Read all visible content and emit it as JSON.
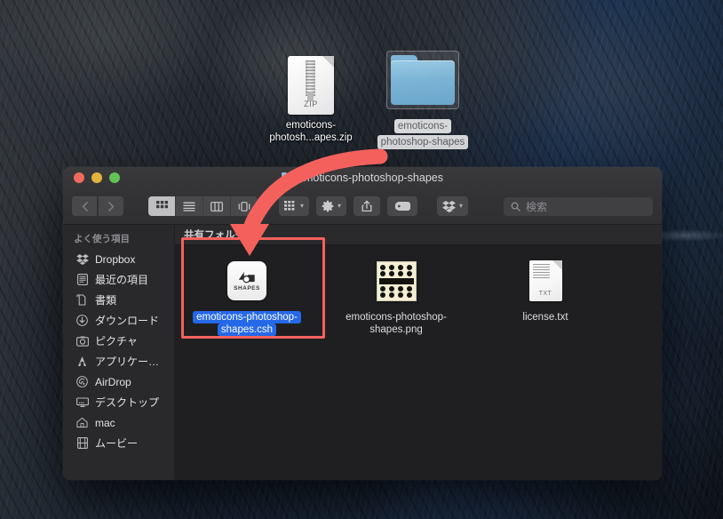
{
  "desktop": {
    "icons": [
      {
        "name": "emoticons-photosh...apes.zip",
        "type": "zip-file-icon",
        "badge": "ZIP",
        "selected": false
      },
      {
        "name_line1": "emoticons-",
        "name_line2": "photoshop-shapes",
        "type": "folder-icon",
        "selected": true
      }
    ]
  },
  "window": {
    "title": "emoticons-photoshop-shapes",
    "traffic_lights": [
      "close",
      "minimize",
      "zoom"
    ],
    "toolbar": {
      "back_label": "‹",
      "forward_label": "›",
      "view_modes": [
        {
          "id": "icon-view",
          "label": "icon",
          "active": true
        },
        {
          "id": "list-view",
          "label": "list",
          "active": false
        },
        {
          "id": "column-view",
          "label": "column",
          "active": false
        },
        {
          "id": "gallery-view",
          "label": "gallery",
          "active": false
        }
      ],
      "arrange_label": "arrange",
      "action_label": "action",
      "share_label": "share",
      "tags_label": "tags",
      "dropbox_label": "dropbox",
      "search_placeholder": "検索",
      "search_value": ""
    },
    "sidebar": {
      "header": "よく使う項目",
      "items": [
        {
          "label": "Dropbox",
          "icon": "dropbox-icon"
        },
        {
          "label": "最近の項目",
          "icon": "recents-icon"
        },
        {
          "label": "書類",
          "icon": "documents-icon"
        },
        {
          "label": "ダウンロード",
          "icon": "downloads-icon"
        },
        {
          "label": "ピクチャ",
          "icon": "pictures-icon"
        },
        {
          "label": "アプリケー…",
          "icon": "applications-icon"
        },
        {
          "label": "AirDrop",
          "icon": "airdrop-icon"
        },
        {
          "label": "デスクトップ",
          "icon": "desktop-icon"
        },
        {
          "label": "mac",
          "icon": "home-icon"
        },
        {
          "label": "ムービー",
          "icon": "movies-icon"
        }
      ]
    },
    "content": {
      "section_header": "共有フォルダ",
      "files": [
        {
          "name": "emoticons-photoshop-shapes.csh",
          "icon": "shapes-file-icon",
          "icon_badge": "SHAPES",
          "selected": true
        },
        {
          "name": "emoticons-photoshop-shapes.png",
          "icon": "image-thumbnail-icon",
          "selected": false
        },
        {
          "name": "license.txt",
          "icon": "text-file-icon",
          "icon_badge": "TXT",
          "selected": false
        }
      ]
    }
  },
  "annotation": {
    "highlight_color": "#f4615c",
    "arrow_color": "#f4615c",
    "selection_color": "#2568e8"
  }
}
